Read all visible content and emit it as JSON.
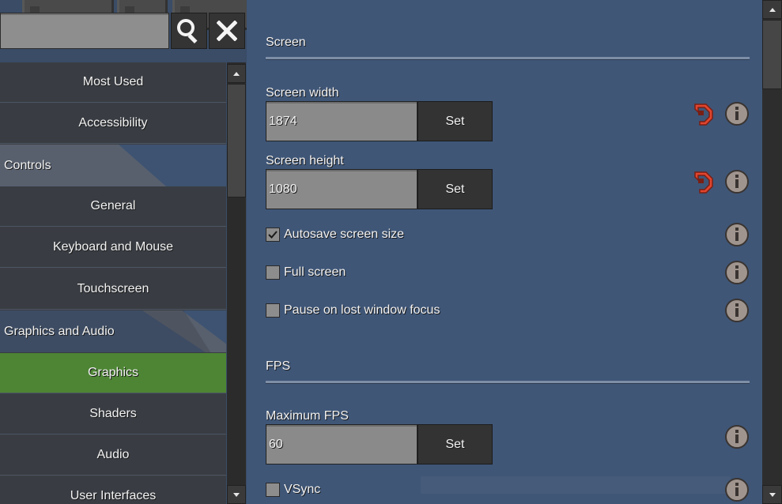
{
  "search": {
    "value": ""
  },
  "sidebar": {
    "items": [
      {
        "label": "Most Used",
        "kind": "sub"
      },
      {
        "label": "Accessibility",
        "kind": "sub"
      },
      {
        "label": "Controls",
        "kind": "header"
      },
      {
        "label": "General",
        "kind": "sub"
      },
      {
        "label": "Keyboard and Mouse",
        "kind": "sub"
      },
      {
        "label": "Touchscreen",
        "kind": "sub"
      },
      {
        "label": "Graphics and Audio",
        "kind": "header"
      },
      {
        "label": "Graphics",
        "kind": "active"
      },
      {
        "label": "Shaders",
        "kind": "sub"
      },
      {
        "label": "Audio",
        "kind": "sub"
      },
      {
        "label": "User Interfaces",
        "kind": "sub"
      }
    ]
  },
  "main": {
    "screen_section": "Screen",
    "screen_width": {
      "label": "Screen width",
      "value": "1874",
      "button": "Set"
    },
    "screen_height": {
      "label": "Screen height",
      "value": "1080",
      "button": "Set"
    },
    "autosave": {
      "label": "Autosave screen size",
      "checked": true
    },
    "fullscreen": {
      "label": "Full screen",
      "checked": false
    },
    "pause_focus": {
      "label": "Pause on lost window focus",
      "checked": false
    },
    "fps_section": "FPS",
    "max_fps": {
      "label": "Maximum FPS",
      "value": "60",
      "button": "Set"
    },
    "vsync": {
      "label": "VSync",
      "checked": false
    }
  },
  "icons": {
    "search": "search-icon",
    "clear": "close-icon",
    "reset": "reset-icon",
    "info": "info-icon"
  },
  "colors": {
    "accent_active": "#4d8534",
    "panel": "#3f5677",
    "reset": "#e0452f"
  }
}
